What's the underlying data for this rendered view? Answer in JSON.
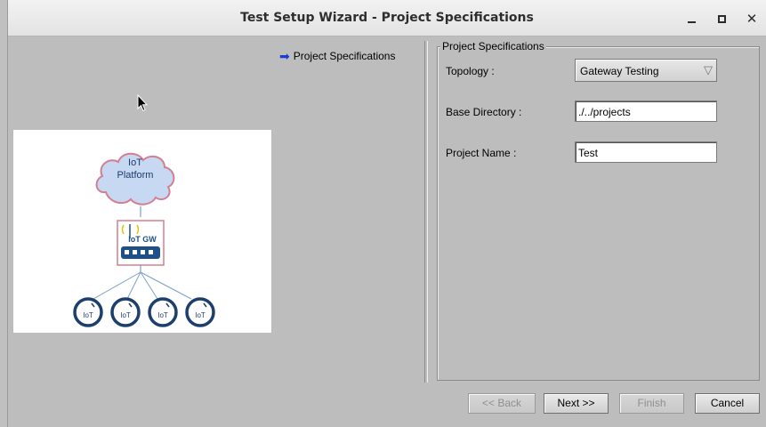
{
  "window": {
    "title": "Test Setup Wizard - Project Specifications",
    "controls": {
      "minimize": "minimize-icon",
      "maximize": "maximize-icon",
      "close": "close-icon"
    }
  },
  "nav": {
    "current_step": "Project Specifications",
    "arrow_icon": "right-arrow-icon",
    "arrow_color": "#1a3cd6"
  },
  "diagram": {
    "cloud_line1": "IoT",
    "cloud_line2": "Platform",
    "gateway_label": "IoT GW",
    "devices": [
      "IoT",
      "IoT",
      "IoT",
      "IoT"
    ]
  },
  "form": {
    "group_title": "Project Specifications",
    "topology_label": "Topology :",
    "topology_value": "Gateway Testing",
    "base_dir_label": "Base Directory :",
    "base_dir_value": "./../projects",
    "project_name_label": "Project Name :",
    "project_name_value": "Test"
  },
  "buttons": {
    "back": "<< Back",
    "next": "Next >>",
    "finish": "Finish",
    "cancel": "Cancel"
  }
}
